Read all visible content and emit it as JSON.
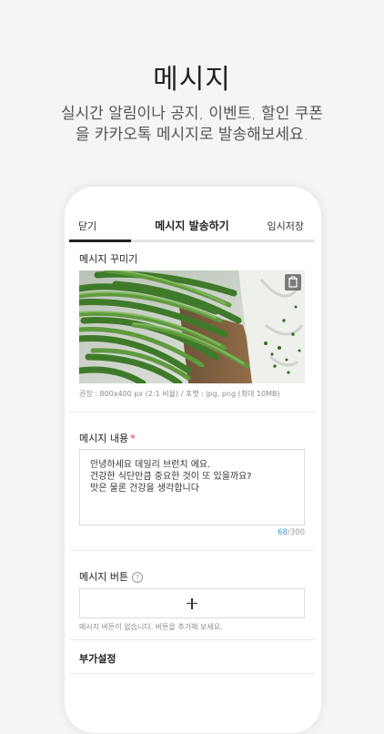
{
  "hero": {
    "title": "메시지",
    "subtitle_line1": "실시간 알림이나 공지, 이벤트, 할인 쿠폰",
    "subtitle_line2": "을 카카오톡 메시지로 발송해보세요."
  },
  "topbar": {
    "close_label": "닫기",
    "title": "메시지 발송하기",
    "draft_label": "임시저장"
  },
  "progress": {
    "fraction": 0.25
  },
  "decorate": {
    "label": "메시지 꾸미기",
    "image_icon": "green-beans-photo",
    "delete_icon": "trash-icon",
    "hint": "권장 : 800x400 px (2:1 비율) / 포맷 : jpg, png (최대 10MB)"
  },
  "content": {
    "label": "메시지 내용",
    "required_mark": "*",
    "lines": [
      "안녕하세요 데일리 브런치 에요.",
      "건강한 식단만큼 중요한 것이 또 있을까요?",
      "맛은 물론 건강을 생각합니다"
    ],
    "count_current": "68",
    "count_max": "/300"
  },
  "buttons": {
    "label": "메시지 버튼",
    "help_icon": "?",
    "add_icon": "plus-icon",
    "empty_hint": "메시지 버튼이 없습니다. 버튼을 추가해 보세요."
  },
  "extra": {
    "label": "부가설정"
  },
  "colors": {
    "accent_blue": "#34a3d8",
    "required_red": "#e0313a",
    "background": "#f5f5f5"
  }
}
